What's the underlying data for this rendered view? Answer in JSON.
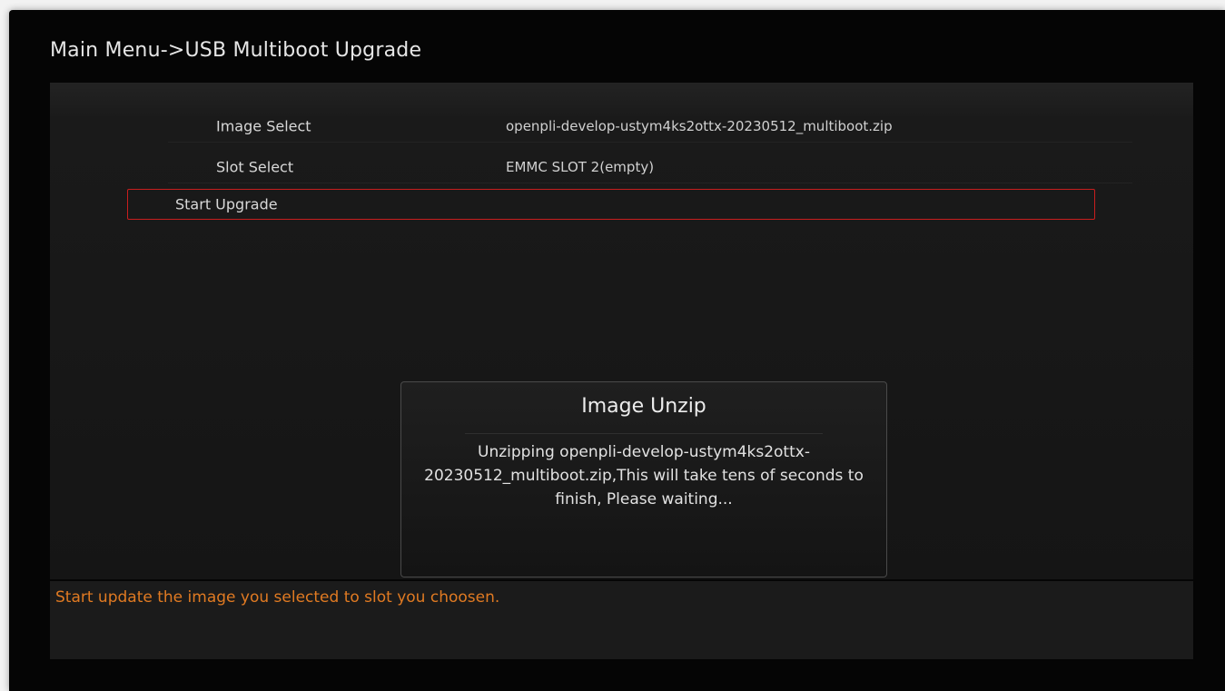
{
  "header": {
    "title": "Main Menu->USB Multiboot Upgrade"
  },
  "menu": {
    "items": [
      {
        "label": "Image Select",
        "value": "openpli-develop-ustym4ks2ottx-20230512_multiboot.zip"
      },
      {
        "label": "Slot Select",
        "value": "EMMC SLOT 2(empty)"
      },
      {
        "label": "Start Upgrade",
        "value": ""
      }
    ],
    "selected_index": 2
  },
  "dialog": {
    "title": "Image Unzip",
    "message": "Unzipping openpli-develop-ustym4ks2ottx-20230512_multiboot.zip,This will take tens of seconds to finish, Please waiting..."
  },
  "help": {
    "text": "Start update the image you selected to slot you choosen."
  },
  "colors": {
    "background": "#050505",
    "panel": "#1a1a1a",
    "selection_border": "#c81e1e",
    "help_text": "#e07a22",
    "text": "#d8d8d8"
  }
}
